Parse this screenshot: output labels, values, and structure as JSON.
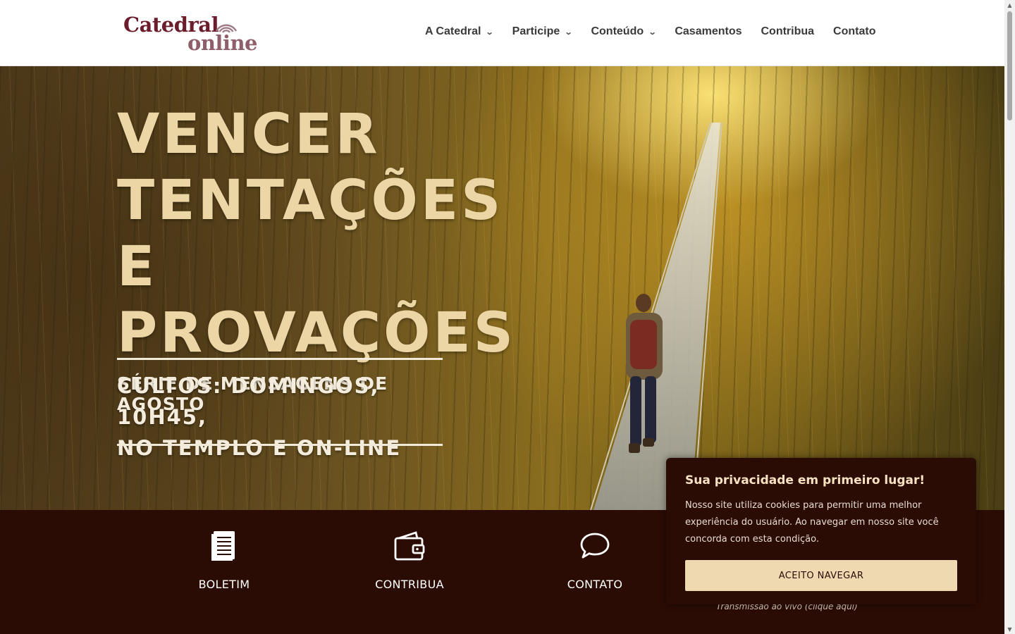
{
  "header": {
    "logo_top": "Catedral",
    "logo_bottom": "online",
    "nav": [
      {
        "label": "A Catedral",
        "has_dropdown": true
      },
      {
        "label": "Participe",
        "has_dropdown": true
      },
      {
        "label": "Conteúdo",
        "has_dropdown": true
      },
      {
        "label": "Casamentos",
        "has_dropdown": false
      },
      {
        "label": "Contribua",
        "has_dropdown": false
      },
      {
        "label": "Contato",
        "has_dropdown": false
      }
    ],
    "dropdown_glyph": "⌄"
  },
  "hero": {
    "title_line1": "VENCER",
    "title_line2": "TENTAÇÕES",
    "title_line3": "E PROVAÇÕES",
    "subtitle": "SÉRIE DE MENSAGENS DE AGOSTO",
    "cultos_line1": "CULTOS: DOMINGOS, 10H45,",
    "cultos_line2": "NO TEMPLO E ON-LINE"
  },
  "band": {
    "items": [
      {
        "label": "BOLETIM",
        "icon": "document-icon"
      },
      {
        "label": "CONTRIBUA",
        "icon": "wallet-icon"
      },
      {
        "label": "CONTATO",
        "icon": "chat-bubble-icon"
      }
    ],
    "live_text": "Transmissão ao vivo (clique aqui)"
  },
  "cookie": {
    "title": "Sua privacidade em primeiro lugar!",
    "text": "Nosso site utiliza cookies para permitir uma melhor experiência do usuário. Ao navegar em nosso site você concorda com esta condição.",
    "button": "ACEITO NAVEGAR"
  },
  "colors": {
    "brand": "#6b1d2c",
    "band_bg": "#2a0c05",
    "hero_title": "#ecd6a6",
    "cookie_button": "#eed9b0"
  }
}
